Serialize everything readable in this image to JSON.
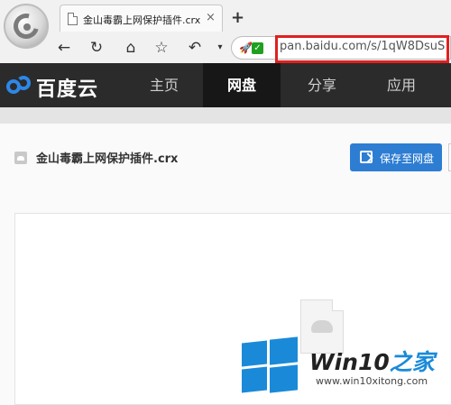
{
  "browser": {
    "tab_title": "金山毒霸上网保护插件.crx",
    "tab_close": "×",
    "new_tab": "+",
    "nav": {
      "back": "←",
      "reload": "↻",
      "home": "⌂",
      "star": "☆",
      "undo": "↶",
      "more": "▾"
    },
    "address_icons": {
      "rocket": "🚀",
      "check": "✓"
    },
    "url": "pan.baidu.com/s/1qW8DsuS",
    "url_highlight_color": "#e02020"
  },
  "header": {
    "brand": "百度云",
    "nav_items": [
      "主页",
      "网盘",
      "分享",
      "应用"
    ],
    "active_nav": "网盘",
    "bg_color": "#2b2b2b",
    "accent": "#2e87e6"
  },
  "file": {
    "name": "金山毒霸上网保护插件.crx",
    "save_button": "保存至网盘",
    "save_button_color": "#2d7dd2"
  },
  "watermark": {
    "title_prefix": "Win10",
    "title_suffix": "之家",
    "url": "www.win10xitong.com"
  },
  "icons": [
    "browser-logo-icon",
    "page-icon",
    "back-icon",
    "reload-icon",
    "home-icon",
    "star-icon",
    "undo-icon",
    "rocket-icon",
    "check-icon",
    "baidu-cloud-logo-icon",
    "file-icon",
    "save-icon",
    "document-icon",
    "windows-logo-icon"
  ]
}
